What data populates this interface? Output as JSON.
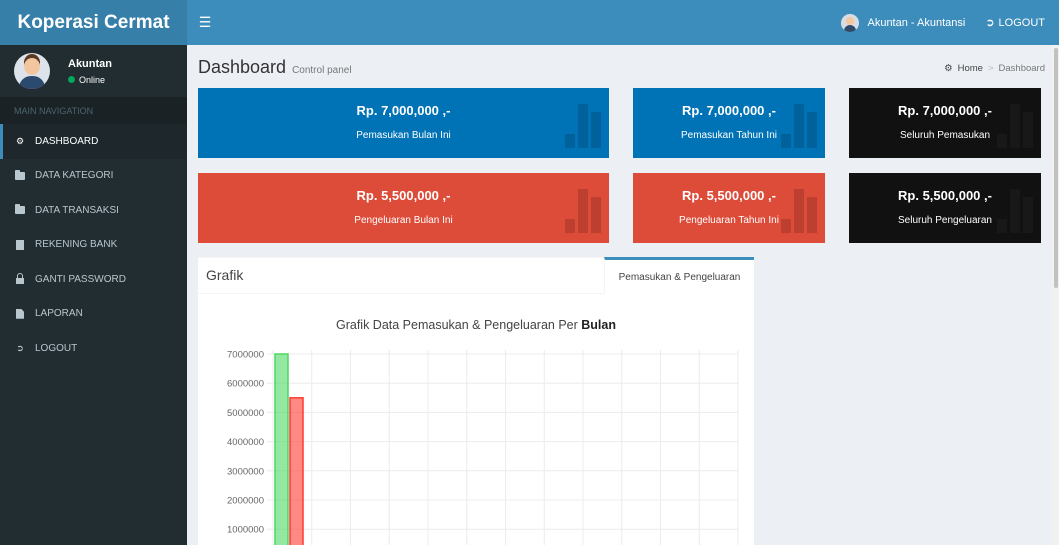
{
  "app": {
    "name": "Koperasi Cermat"
  },
  "topbar": {
    "toggle_icon": "bars-icon",
    "user_label": "Akuntan - Akuntansi",
    "logout_label": "LOGOUT"
  },
  "sidebar": {
    "user_name": "Akuntan",
    "user_status": "Online",
    "nav_header": "MAIN NAVIGATION",
    "items": [
      {
        "label": "DASHBOARD",
        "icon": "dashboard-icon"
      },
      {
        "label": "DATA KATEGORI",
        "icon": "folder-icon"
      },
      {
        "label": "DATA TRANSAKSI",
        "icon": "folder-icon"
      },
      {
        "label": "REKENING BANK",
        "icon": "bank-icon"
      },
      {
        "label": "GANTI PASSWORD",
        "icon": "lock-icon"
      },
      {
        "label": "LAPORAN",
        "icon": "file-icon"
      },
      {
        "label": "LOGOUT",
        "icon": "sign-out-icon"
      }
    ]
  },
  "header": {
    "title": "Dashboard",
    "subtitle": "Control panel",
    "breadcrumb_home": "Home",
    "breadcrumb_sep": ">",
    "breadcrumb_current": "Dashboard"
  },
  "stats": [
    {
      "amount": "Rp. 7,000,000 ,-",
      "label": "Pemasukan Bulan Ini",
      "color": "#0073b7"
    },
    {
      "amount": "Rp. 7,000,000 ,-",
      "label": "Pemasukan Tahun Ini",
      "color": "#0073b7"
    },
    {
      "amount": "Rp. 7,000,000 ,-",
      "label": "Seluruh Pemasukan",
      "color": "#111111"
    },
    {
      "amount": "Rp. 5,500,000 ,-",
      "label": "Pengeluaran Bulan Ini",
      "color": "#dd4b39"
    },
    {
      "amount": "Rp. 5,500,000 ,-",
      "label": "Pengeluaran Tahun Ini",
      "color": "#dd4b39"
    },
    {
      "amount": "Rp. 5,500,000 ,-",
      "label": "Seluruh Pengeluaran",
      "color": "#111111"
    }
  ],
  "card": {
    "title": "Grafik",
    "tab_label": "Pemasukan & Pengeluaran"
  },
  "chart_data": {
    "type": "bar",
    "title_prefix": "Grafik Data Pemasukan & Pengeluaran Per ",
    "title_bold": "Bulan",
    "yticks": [
      7000000,
      6000000,
      5000000,
      4000000,
      3000000,
      2000000,
      1000000
    ],
    "ylim": [
      0,
      7000000
    ],
    "grid": true,
    "series": [
      {
        "values": [
          7000000
        ],
        "color": "#4cd964"
      },
      {
        "values": [
          5500000
        ],
        "color": "#ff3b30"
      }
    ]
  }
}
